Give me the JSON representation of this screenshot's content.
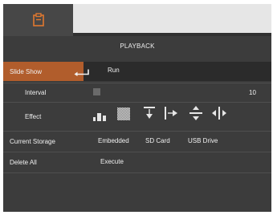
{
  "header": {
    "tab_icon": "playback-clipboard-icon",
    "accent_color": "#e0782f"
  },
  "page_title": "PLAYBACK",
  "slide_show": {
    "label": "Slide Show",
    "action_icon": "enter-return-icon",
    "action_label": "Run",
    "highlight_color": "#b15d2c"
  },
  "interval": {
    "label": "Interval",
    "value": "10"
  },
  "effect": {
    "label": "Effect",
    "options": [
      "bars-effect-icon",
      "dissolve-effect-icon",
      "wipe-down-effect-icon",
      "wipe-right-effect-icon",
      "expand-vertical-effect-icon",
      "expand-horizontal-effect-icon"
    ]
  },
  "storage": {
    "label": "Current Storage",
    "options": [
      "Embedded",
      "SD Card",
      "USB Drive"
    ],
    "selected": "SD Card"
  },
  "delete_all": {
    "label": "Delete All",
    "action": "Execute"
  }
}
